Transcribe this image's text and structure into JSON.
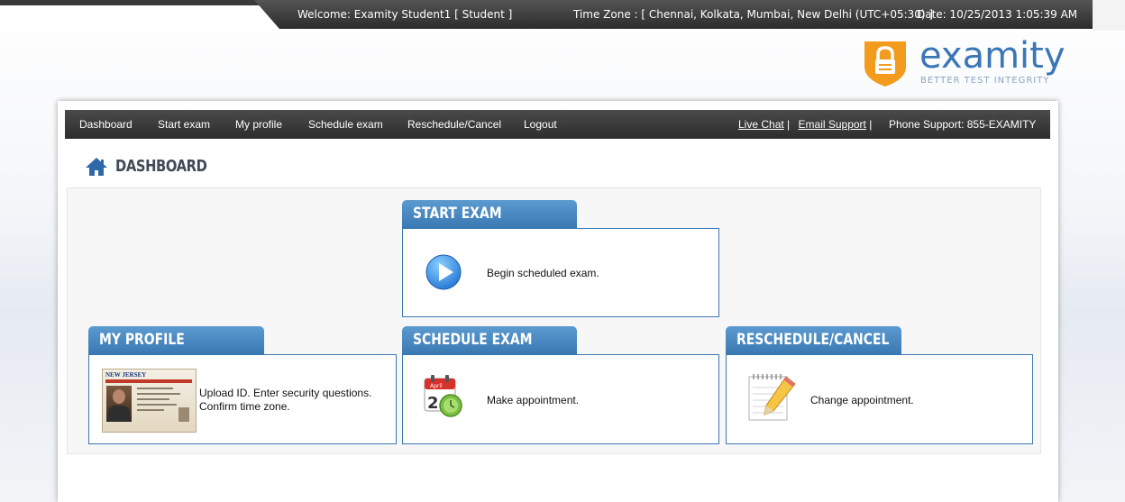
{
  "header": {
    "welcome": "Welcome: Examity Student1 [ Student ]",
    "timezone": "Time Zone : [ Chennai, Kolkata, Mumbai, New Delhi (UTC+05:30) ]",
    "date": "Date: 10/25/2013 1:05:39 AM"
  },
  "brand": {
    "name": "examity",
    "tagline": "BETTER TEST INTEGRITY",
    "colors": {
      "primary": "#3b76b6",
      "shield": "#f29b1d"
    }
  },
  "nav": {
    "items": [
      "Dashboard",
      "Start exam",
      "My profile",
      "Schedule exam",
      "Reschedule/Cancel",
      "Logout"
    ],
    "live_chat": "Live Chat",
    "email_support": "Email Support",
    "sep": "|",
    "phone": "Phone Support: 855-EXAMITY"
  },
  "page": {
    "title": "DASHBOARD",
    "icon": "home-icon"
  },
  "cards": {
    "start": {
      "title": "START EXAM",
      "text": "Begin scheduled exam.",
      "icon": "play-icon"
    },
    "profile": {
      "title": "MY PROFILE",
      "text": "Upload ID. Enter security questions. Confirm time zone.",
      "icon": "id-card-icon",
      "id_card_text": "NEW JERSEY"
    },
    "schedule": {
      "title": "SCHEDULE EXAM",
      "text": "Make appointment.",
      "icon": "calendar-clock-icon",
      "month": "April",
      "day": "2"
    },
    "reschedule": {
      "title": "RESCHEDULE/CANCEL",
      "text": "Change appointment.",
      "icon": "notepad-pencil-icon"
    }
  }
}
